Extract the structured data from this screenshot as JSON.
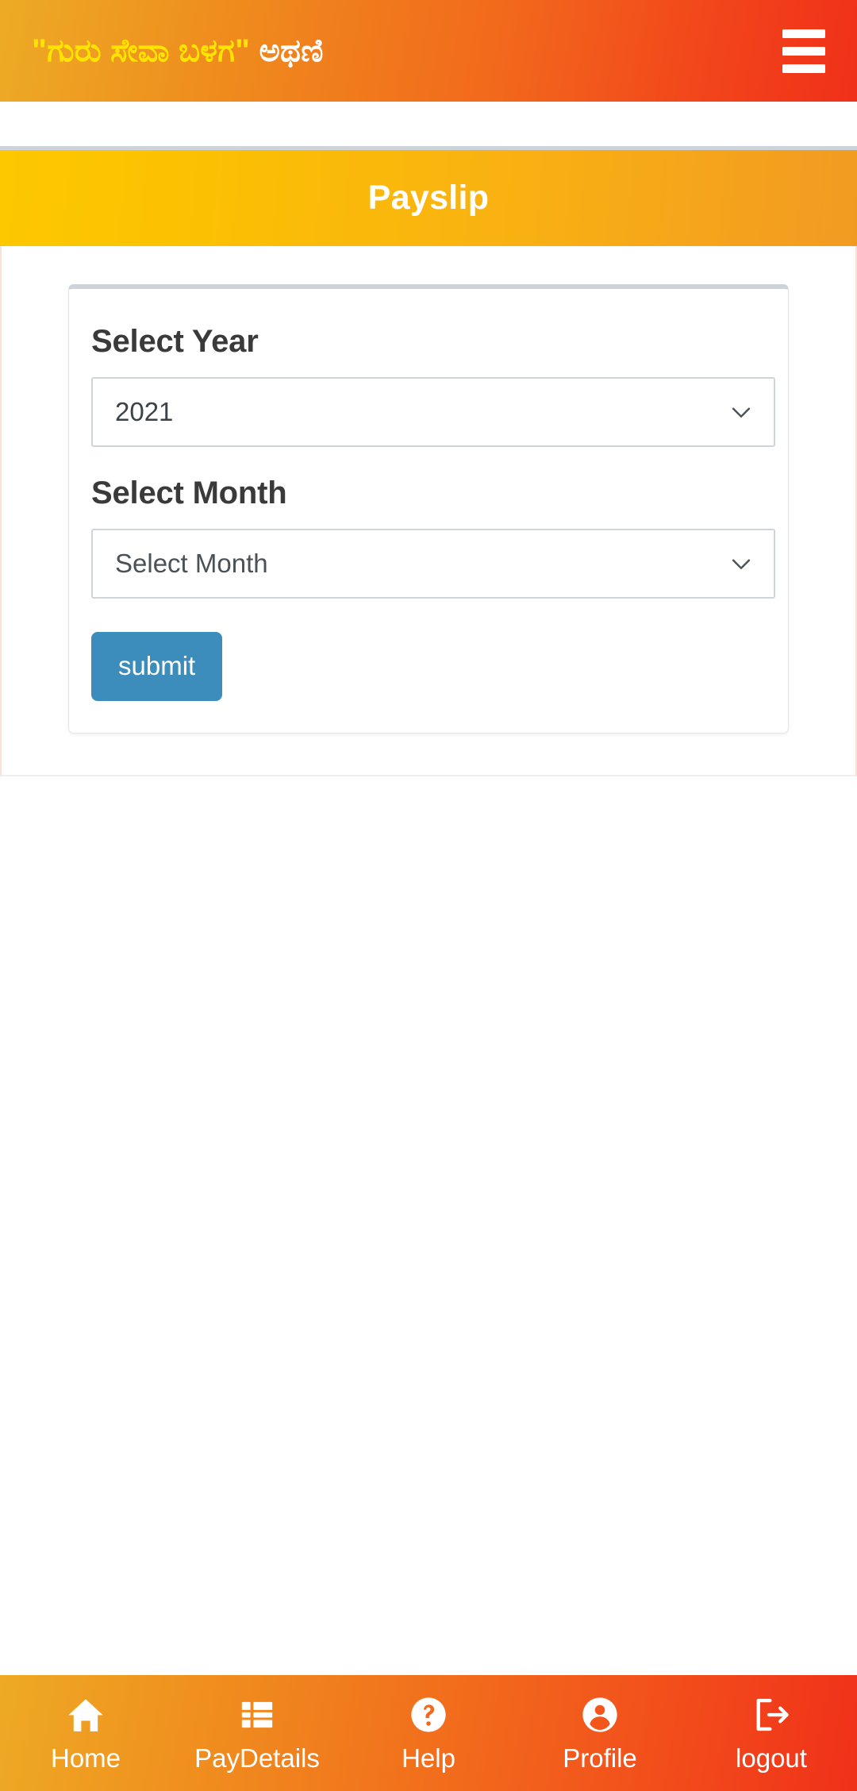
{
  "appbar": {
    "title_quoted": "\"ಗುರು ಸೇವಾ ಬಳಗ\"",
    "title_place": "ಅಥಣಿ",
    "menu_icon": "hamburger-menu-icon"
  },
  "banner": {
    "title": "Payslip"
  },
  "form": {
    "year": {
      "label": "Select Year",
      "value": "2021",
      "dropdown_icon": "chevron-down-icon"
    },
    "month": {
      "label": "Select Month",
      "value": "Select Month",
      "placeholder": "Select Month",
      "dropdown_icon": "chevron-down-icon"
    },
    "submit_label": "submit"
  },
  "bottom_nav": {
    "items": [
      {
        "label": "Home",
        "icon": "home-icon"
      },
      {
        "label": "PayDetails",
        "icon": "list-icon"
      },
      {
        "label": "Help",
        "icon": "question-circle-icon"
      },
      {
        "label": "Profile",
        "icon": "person-circle-icon"
      },
      {
        "label": "logout",
        "icon": "logout-icon"
      }
    ]
  },
  "colors": {
    "appbar_start": "#edab25",
    "appbar_end": "#f0301a",
    "banner_start": "#fdc800",
    "banner_end": "#f29b22",
    "title_highlight": "#ffe400",
    "submit_blue": "#3d8dbc",
    "card_top_border": "#ced3da"
  }
}
